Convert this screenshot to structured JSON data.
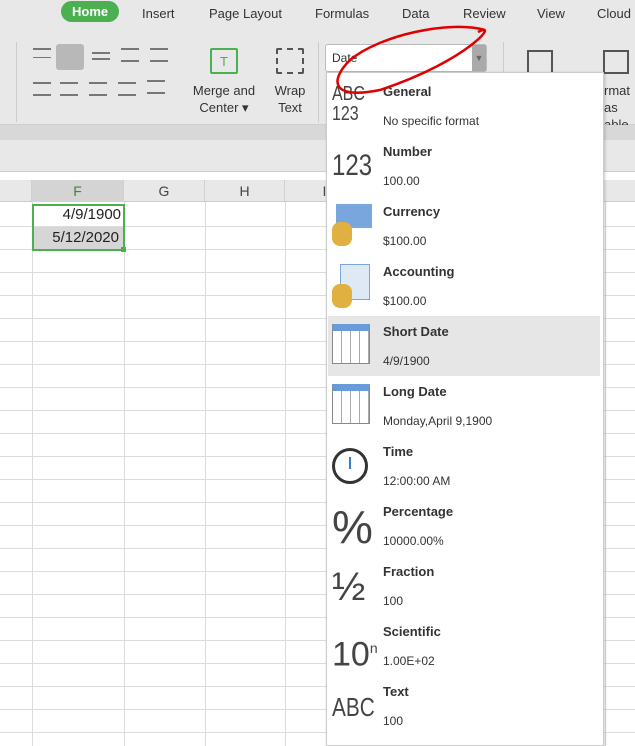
{
  "tabs": [
    "Home",
    "Insert",
    "Page Layout",
    "Formulas",
    "Data",
    "Review",
    "View",
    "Cloud"
  ],
  "ribbon": {
    "merge_label1": "Merge and",
    "merge_label2": "Center",
    "wrap_label1": "Wrap",
    "wrap_label2": "Text",
    "format_value": "Date",
    "fmt_table1": "rmat as",
    "fmt_table2": "able"
  },
  "columns": [
    "F",
    "G",
    "H",
    "I"
  ],
  "cells": {
    "F1": "4/9/1900",
    "F2": "5/12/2020"
  },
  "menu": [
    {
      "title": "General",
      "sample": "No specific format",
      "icon": "abc-123-icon"
    },
    {
      "title": "Number",
      "sample": "100.00",
      "icon": "number-icon"
    },
    {
      "title": "Currency",
      "sample": "$100.00",
      "icon": "currency-icon"
    },
    {
      "title": "Accounting",
      "sample": " $100.00",
      "icon": "accounting-icon"
    },
    {
      "title": "Short Date",
      "sample": "4/9/1900",
      "icon": "calendar-icon"
    },
    {
      "title": "Long Date",
      "sample": "Monday,April 9,1900",
      "icon": "calendar-icon"
    },
    {
      "title": "Time",
      "sample": "12:00:00 AM",
      "icon": "clock-icon"
    },
    {
      "title": "Percentage",
      "sample": "10000.00%",
      "icon": "percent-icon"
    },
    {
      "title": "Fraction",
      "sample": "100",
      "icon": "fraction-icon"
    },
    {
      "title": "Scientific",
      "sample": "1.00E+02",
      "icon": "scientific-icon"
    },
    {
      "title": "Text",
      "sample": "100",
      "icon": "text-icon"
    }
  ],
  "colors": {
    "accent": "#4caf50",
    "annotation": "#e00000",
    "highlight": "#e6e6e6"
  }
}
